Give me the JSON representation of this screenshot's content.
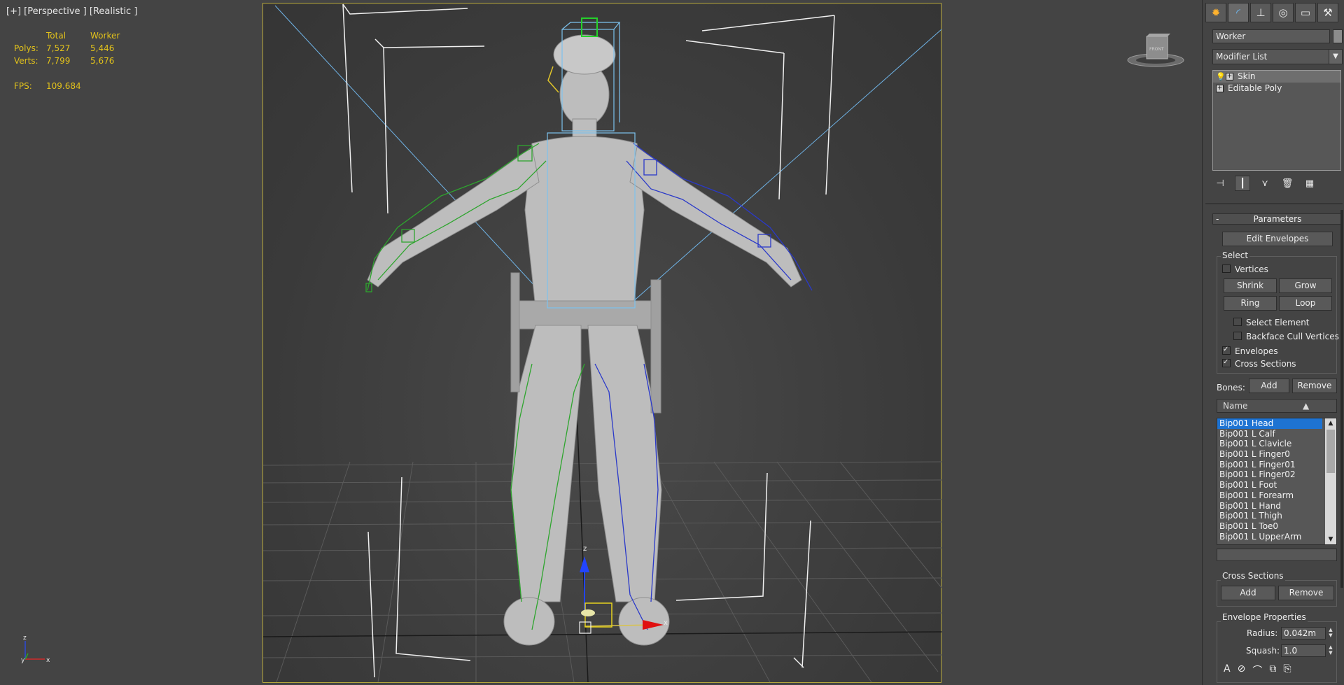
{
  "viewport": {
    "label": "[+] [Perspective ] [Realistic ]",
    "stats": {
      "col_total": "Total",
      "col_object": "Worker",
      "polys_label": "Polys:",
      "polys_total": "7,527",
      "polys_object": "5,446",
      "verts_label": "Verts:",
      "verts_total": "7,799",
      "verts_object": "5,676",
      "fps_label": "FPS:",
      "fps_value": "109.684"
    },
    "viewcube_label": "FRONT",
    "axis_labels": {
      "x": "x",
      "y": "y",
      "z": "z"
    },
    "gizmo_labels": {
      "z": "z",
      "x": "x"
    }
  },
  "command_panel": {
    "tabs": [
      {
        "icon": "create-icon",
        "glyph": "✹"
      },
      {
        "icon": "modify-icon",
        "glyph": "◜"
      },
      {
        "icon": "hierarchy-icon",
        "glyph": "⊥"
      },
      {
        "icon": "motion-icon",
        "glyph": "◎"
      },
      {
        "icon": "display-icon",
        "glyph": "▭"
      },
      {
        "icon": "utilities-icon",
        "glyph": "⚒"
      }
    ],
    "object_name": "Worker",
    "modifier_list": "Modifier List",
    "stack": [
      {
        "name": "Skin",
        "selected": true
      },
      {
        "name": "Editable Poly",
        "selected": false
      }
    ],
    "parameters": {
      "title": "Parameters",
      "edit_envelopes": "Edit Envelopes",
      "select_group": "Select",
      "vertices": "Vertices",
      "shrink": "Shrink",
      "grow": "Grow",
      "ring": "Ring",
      "loop": "Loop",
      "select_element": "Select Element",
      "backface_cull": "Backface Cull Vertices",
      "envelopes": "Envelopes",
      "cross_sections": "Cross Sections",
      "bones_label": "Bones:",
      "add": "Add",
      "remove": "Remove",
      "name_col": "Name",
      "bones": [
        "Bip001 Head",
        "Bip001 L Calf",
        "Bip001 L Clavicle",
        "Bip001 L Finger0",
        "Bip001 L Finger01",
        "Bip001 L Finger02",
        "Bip001 L Foot",
        "Bip001 L Forearm",
        "Bip001 L Hand",
        "Bip001 L Thigh",
        "Bip001 L Toe0",
        "Bip001 L UpperArm"
      ],
      "cross_sections_group": "Cross Sections",
      "cs_add": "Add",
      "cs_remove": "Remove",
      "envelope_props": "Envelope Properties",
      "radius_label": "Radius:",
      "radius_value": "0.042m",
      "squash_label": "Squash:",
      "squash_value": "1.0"
    }
  }
}
